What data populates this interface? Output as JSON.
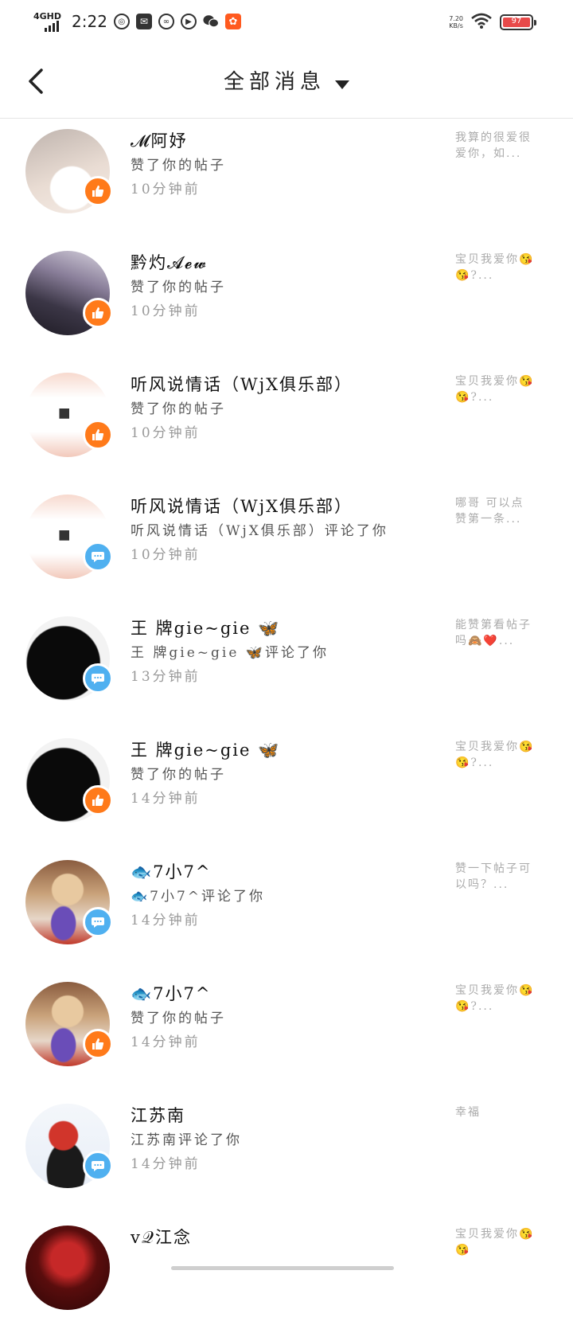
{
  "status_bar": {
    "network": "4GHD",
    "time": "2:22",
    "net_speed_value": "7.20",
    "net_speed_unit": "KB/s",
    "battery": "97"
  },
  "header": {
    "title": "全部消息"
  },
  "messages": [
    {
      "name": "𝓜阿妤",
      "action": "赞了你的帖子",
      "time": "10分钟前",
      "preview": "我算的很爱很爱你，如...",
      "type": "like",
      "avatar_colors": [
        "#e9dcd3",
        "#bfb4ae"
      ]
    },
    {
      "name": "黔灼𝓐𝓮𝔀",
      "action": "赞了你的帖子",
      "time": "10分钟前",
      "preview": "宝贝我爱你😘😘?...",
      "type": "like",
      "avatar_colors": [
        "#3b3646",
        "#8a7f9a"
      ]
    },
    {
      "name": "听风说情话（WjX俱乐部）",
      "action": "赞了你的帖子",
      "time": "10分钟前",
      "preview": "宝贝我爱你😘😘?...",
      "type": "like",
      "avatar_colors": [
        "#f2c9bb",
        "#ffffff"
      ]
    },
    {
      "name": "听风说情话（WjX俱乐部）",
      "action": "听风说情话（WjX俱乐部）评论了你",
      "time": "10分钟前",
      "preview": "哪哥 可以点赞第一条...",
      "type": "comment",
      "avatar_colors": [
        "#f2c9bb",
        "#ffffff"
      ]
    },
    {
      "name": "王 牌gie~gie 🦋",
      "action": "王 牌gie~gie 🦋评论了你",
      "time": "13分钟前",
      "preview": "能赞第看帖子吗🙈❤️...",
      "type": "comment",
      "avatar_colors": [
        "#0a0a0a",
        "#f3f3f3"
      ]
    },
    {
      "name": "王 牌gie~gie 🦋",
      "action": "赞了你的帖子",
      "time": "14分钟前",
      "preview": "宝贝我爱你😘😘?...",
      "type": "like",
      "avatar_colors": [
        "#0a0a0a",
        "#f3f3f3"
      ]
    },
    {
      "name": "🐟7小7^",
      "action": "🐟7小7^评论了你",
      "time": "14分钟前",
      "preview": "赞一下帖子可以吗？...",
      "type": "comment",
      "avatar_colors": [
        "#c9a27a",
        "#8a5c3f"
      ]
    },
    {
      "name": "🐟7小7^",
      "action": "赞了你的帖子",
      "time": "14分钟前",
      "preview": "宝贝我爱你😘😘?...",
      "type": "like",
      "avatar_colors": [
        "#c9a27a",
        "#8a5c3f"
      ]
    },
    {
      "name": "江苏南",
      "action": "江苏南评论了你",
      "time": "14分钟前",
      "preview": "幸福",
      "type": "comment",
      "avatar_colors": [
        "#e8eef7",
        "#d1352b"
      ]
    },
    {
      "name": "v𝒬江念",
      "action": "",
      "time": "",
      "preview": "宝贝我爱你😘😘",
      "type": "like",
      "avatar_colors": [
        "#5a0d0d",
        "#c62828"
      ]
    }
  ]
}
